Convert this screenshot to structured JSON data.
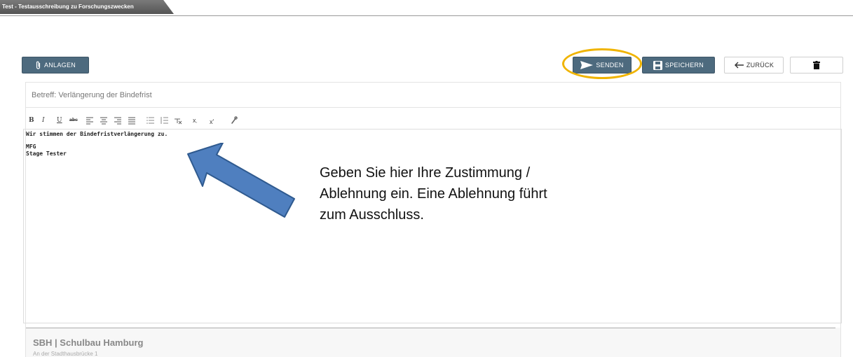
{
  "tab": {
    "title": "Test - Testausschreibung zu Forschungszwecken"
  },
  "toolbar": {
    "attachments_label": "ANLAGEN",
    "send_label": "SENDEN",
    "save_label": "SPEICHERN",
    "back_label": "ZURÜCK"
  },
  "message": {
    "subject": "Betreff: Verlängerung der Bindefrist",
    "body_line1": "Wir stimmen der Bindefristverlängerung zu.",
    "body_line2": "MFG",
    "body_line3": "Stage Tester"
  },
  "format_toolbar": {
    "bold": "B",
    "italic": "I",
    "underline": "U",
    "strike": "abc",
    "subscript": "x",
    "superscript": "x"
  },
  "signature": {
    "company": "SBH | Schulbau Hamburg",
    "address": "An der Stadthausbrücke 1"
  },
  "annotation": {
    "text": "Geben Sie hier Ihre Zustimmung / Ablehnung ein. Eine Ablehnung führt zum Ausschluss."
  },
  "colors": {
    "button_dark": "#4d6a7e",
    "highlight": "#f0b400",
    "arrow_fill": "#4f7fbf"
  }
}
